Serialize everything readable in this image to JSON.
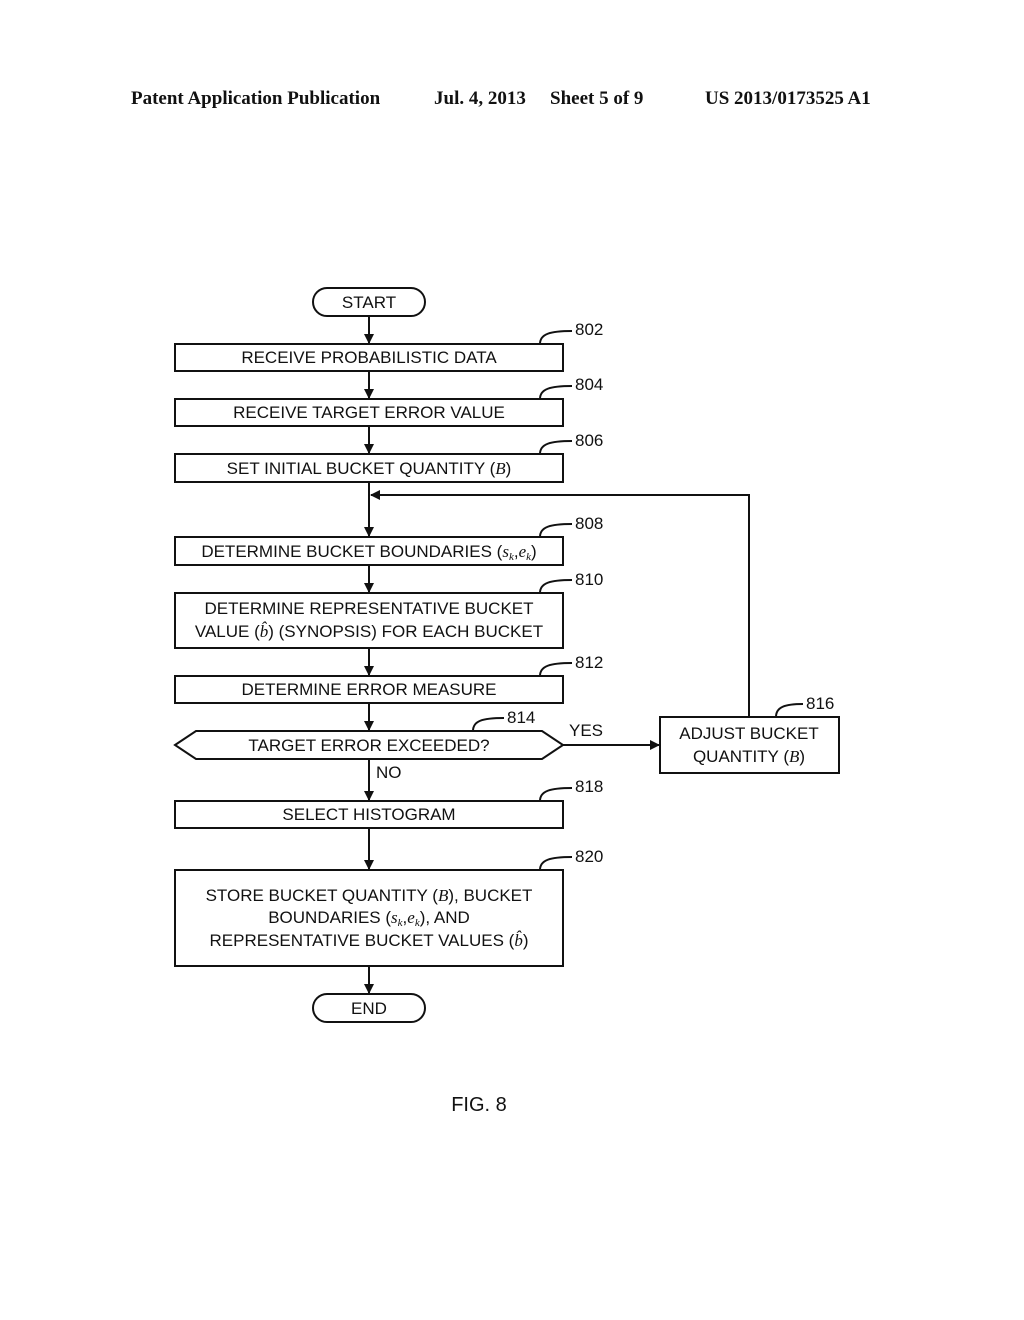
{
  "header": {
    "publication": "Patent Application Publication",
    "date": "Jul. 4, 2013",
    "sheet": "Sheet 5 of 9",
    "number": "US 2013/0173525 A1"
  },
  "flowchart": {
    "start": "START",
    "end": "END",
    "steps": {
      "s802": {
        "ref": "802",
        "text": "RECEIVE PROBABILISTIC DATA"
      },
      "s804": {
        "ref": "804",
        "text": "RECEIVE TARGET ERROR VALUE"
      },
      "s806": {
        "ref": "806",
        "text": "SET INITIAL BUCKET QUANTITY (",
        "var": "B",
        "close": ")"
      },
      "s808": {
        "ref": "808",
        "text": "DETERMINE BUCKET BOUNDARIES (",
        "var1": "s",
        "sub1": "k",
        "sep": ",",
        "var2": "e",
        "sub2": "k",
        "close": ")"
      },
      "s810": {
        "ref": "810",
        "line1": "DETERMINE REPRESENTATIVE BUCKET",
        "line2a": "VALUE (",
        "var": "b̂",
        "line2b": ") (SYNOPSIS) FOR EACH BUCKET"
      },
      "s812": {
        "ref": "812",
        "text": "DETERMINE ERROR MEASURE"
      },
      "s814": {
        "ref": "814",
        "text": "TARGET ERROR EXCEEDED?",
        "yes": "YES",
        "no": "NO"
      },
      "s816": {
        "ref": "816",
        "line1": "ADJUST BUCKET",
        "line2a": "QUANTITY (",
        "var": "B",
        "close": ")"
      },
      "s818": {
        "ref": "818",
        "text": "SELECT HISTOGRAM"
      },
      "s820": {
        "ref": "820",
        "line1a": "STORE BUCKET QUANTITY (",
        "line1var": "B",
        "line1b": "), BUCKET",
        "line2a": "BOUNDARIES (",
        "line2var1": "s",
        "line2sub1": "k",
        "line2sep": ",",
        "line2var2": "e",
        "line2sub2": "k",
        "line2b": "), AND",
        "line3a": "REPRESENTATIVE BUCKET VALUES (",
        "line3var": "b̂",
        "line3b": ")"
      }
    }
  },
  "figure_label": "FIG. 8"
}
